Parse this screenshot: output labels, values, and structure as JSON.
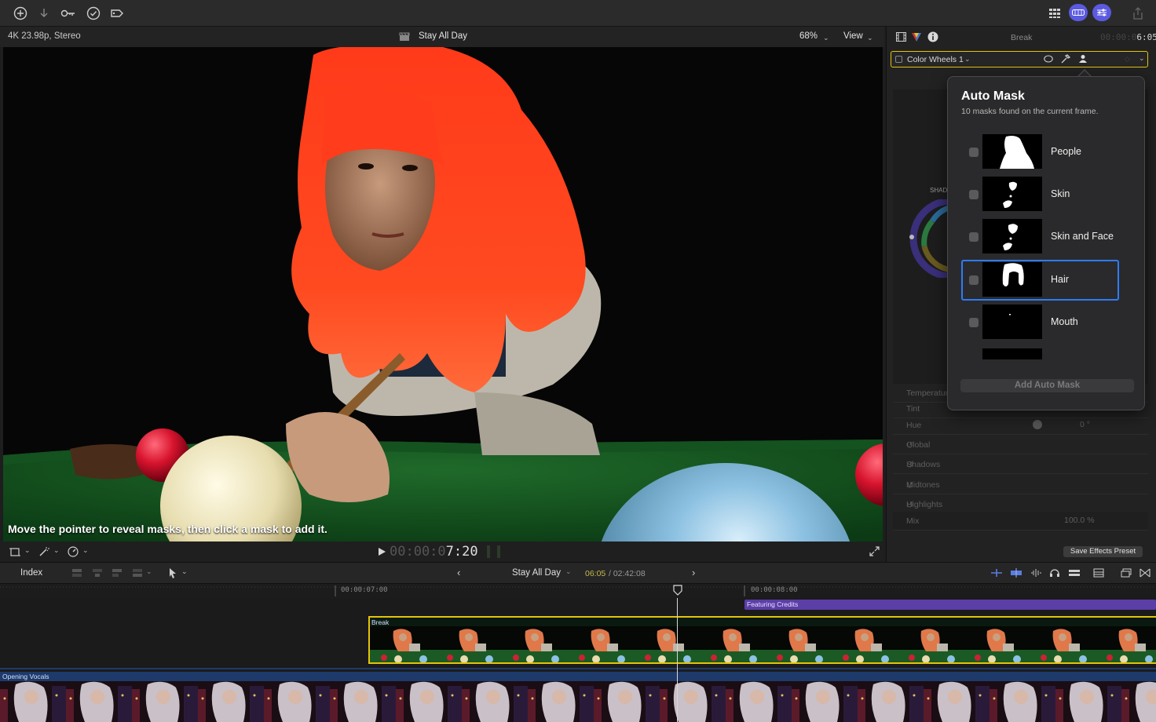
{
  "colors": {
    "accent": "#5b5ae0",
    "selection_yellow": "#e3c40a",
    "title_purple": "#5b3ea6",
    "focus_blue": "#2e7cf6",
    "timecode_green": "#c5b84a"
  },
  "toolbar": {
    "icons": [
      "plus-circle-icon",
      "download-icon",
      "key-icon",
      "checkmark-circle-icon",
      "tag-icon",
      "grid-icon",
      "browser-pill-icon",
      "inspector-sliders-icon",
      "share-icon"
    ]
  },
  "viewer": {
    "format_label": "4K 23.98p, Stereo",
    "clip_title": "Stay All Day",
    "zoom": "68%",
    "view_menu": "View",
    "caption": "Move the pointer to reveal masks, then click a mask to add it.",
    "timecode_dim": "00:00:0",
    "timecode_live": "7:20"
  },
  "inspector": {
    "clip_name": "Break",
    "duration_dim": "00:00:0",
    "duration_live": "6:05",
    "effect_name": "Color Wheels 1",
    "wheel_label": "SHAD",
    "rows": [
      "Temperature",
      "Tint",
      "Hue",
      "Global",
      "Shadows",
      "Midtones",
      "Highlights",
      "Mix"
    ],
    "hue_value": "0 °",
    "mix_value": "100.0 %",
    "save_preset": "Save Effects Preset"
  },
  "auto_mask": {
    "title": "Auto Mask",
    "subtitle": "10 masks found on the current frame.",
    "items": [
      {
        "label": "People",
        "checked": false,
        "selected": false
      },
      {
        "label": "Skin",
        "checked": false,
        "selected": false
      },
      {
        "label": "Skin and Face",
        "checked": false,
        "selected": false
      },
      {
        "label": "Hair",
        "checked": false,
        "selected": true
      },
      {
        "label": "Mouth",
        "checked": false,
        "selected": false
      }
    ],
    "add_button": "Add Auto Mask"
  },
  "timeline_bar": {
    "index_button": "Index",
    "project_name": "Stay All Day",
    "position": "06:05",
    "total": "/ 02:42:08"
  },
  "ruler": {
    "mark_1": "00:00:07:00",
    "mark_2": "00:00:08:00"
  },
  "timeline": {
    "title_clip": "Featuring Credits",
    "main_clip": "Break",
    "audio_clip": "Opening Vocals"
  }
}
